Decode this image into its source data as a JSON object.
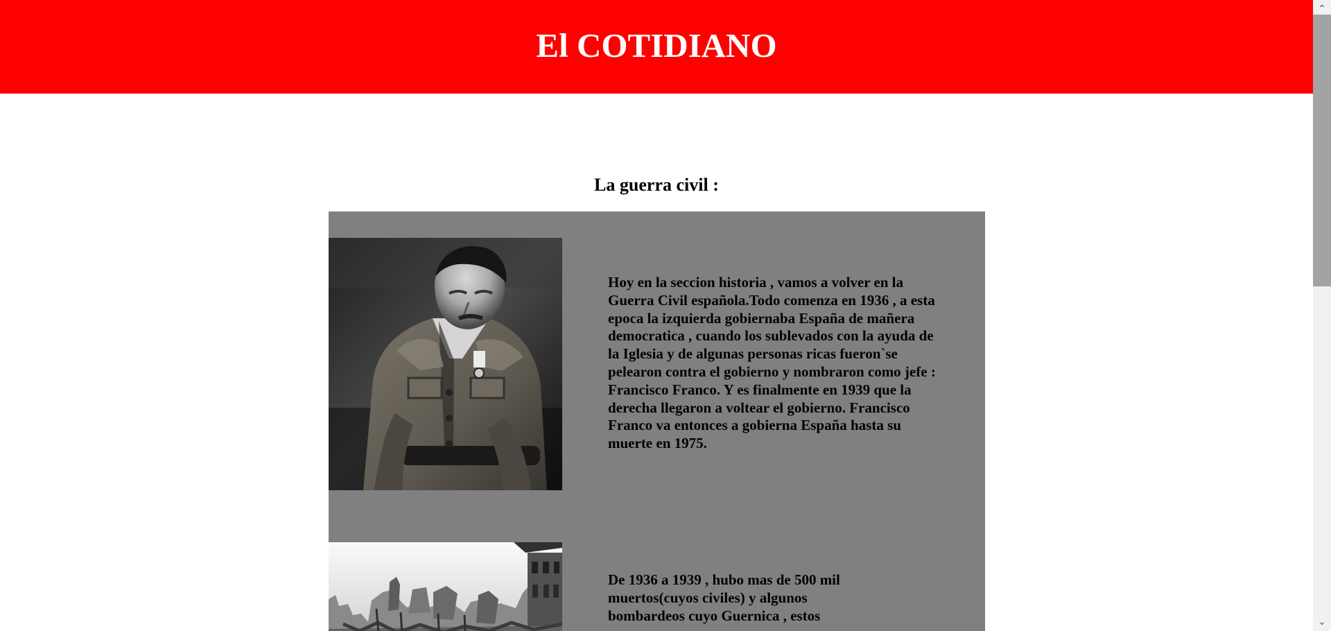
{
  "header": {
    "title": "El COTIDIANO",
    "background_color": "#ff0000",
    "title_color": "#ffffff"
  },
  "section": {
    "heading": "La guerra civil :"
  },
  "articles": [
    {
      "image_icon": "franco-portrait-photo",
      "text": "Hoy en la seccion historia , vamos a volver en la Guerra Civil española.Todo comenza en 1936 , a esta epoca la izquierda gobiernaba España de mañera democratica , cuando los sublevados con la ayuda de la Iglesia y de algunas personas ricas fueron`se pelearon contra el gobierno y nombraron como jefe : Francisco Franco. Y es finalmente en 1939 que la derecha llegaron a voltear el gobierno. Francisco Franco va entonces a gobierna España hasta su muerte en 1975."
    },
    {
      "image_icon": "bombed-ruins-photo",
      "text": "De 1936 a 1939 , hubo mas de 500 mil muertos(cuyos civiles) y algunos bombardeos cuyo Guernica , estos"
    }
  ],
  "colors": {
    "panel_background": "#808080",
    "page_background": "#ffffff",
    "text": "#000000"
  },
  "scrollbar": {
    "up_icon": "chevron-up-icon",
    "down_icon": "chevron-down-icon",
    "up_glyph": "⌃",
    "down_glyph": "⌄"
  }
}
